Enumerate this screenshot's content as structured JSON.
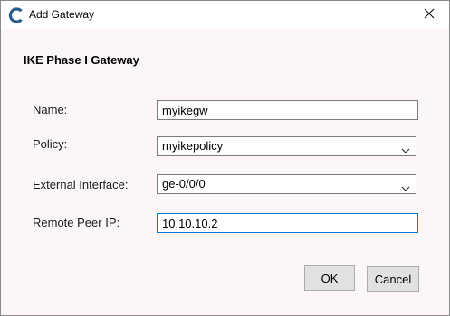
{
  "window": {
    "title": "Add Gateway",
    "close_glyph": "✕",
    "app_icon": "c-logo-icon",
    "accent_color": "#2a5d8f"
  },
  "section": {
    "title": "IKE Phase I Gateway"
  },
  "form": {
    "name": {
      "label": "Name:",
      "value": "myikegw"
    },
    "policy": {
      "label": "Policy:",
      "value": "myikepolicy"
    },
    "external_interface": {
      "label": "External Interface:",
      "value": "ge-0/0/0"
    },
    "remote_peer_ip": {
      "label": "Remote Peer IP:",
      "value": "10.10.10.2"
    }
  },
  "buttons": {
    "ok_label": "OK",
    "cancel_label": "Cancel"
  }
}
